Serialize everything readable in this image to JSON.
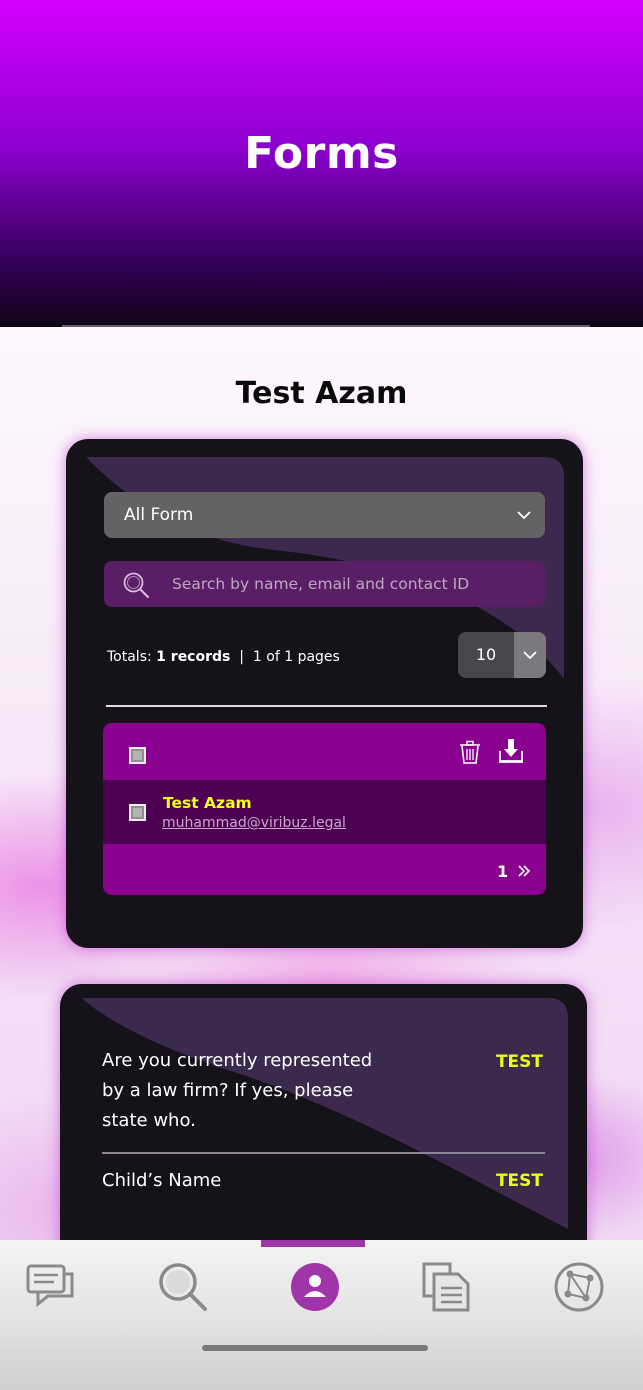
{
  "header": {
    "title": "Forms"
  },
  "page": {
    "title": "Test Azam"
  },
  "filters": {
    "form_select": "All Form",
    "search_placeholder": "Search by name, email and contact ID",
    "totals_label": "Totals:",
    "totals_records": "1 records",
    "separator": "|",
    "pages_text": "1 of 1 pages",
    "per_page": "10"
  },
  "table": {
    "rows": [
      {
        "name": "Test Azam",
        "email": "muhammad@viribuz.legal"
      }
    ],
    "current_page": "1"
  },
  "details": {
    "fields": [
      {
        "label": "Are you currently represented by a law firm? If yes, please state who.",
        "value": "TEST"
      },
      {
        "label": "Child’s Name",
        "value": "TEST"
      }
    ]
  },
  "bottom_nav": {
    "items": [
      {
        "icon": "chat-icon"
      },
      {
        "icon": "search-icon"
      },
      {
        "icon": "profile-icon",
        "active": true
      },
      {
        "icon": "documents-icon"
      },
      {
        "icon": "network-icon"
      }
    ]
  },
  "colors": {
    "accent": "#8a008f",
    "highlight": "#f2ff1a",
    "active_nav": "#9f35a8"
  }
}
